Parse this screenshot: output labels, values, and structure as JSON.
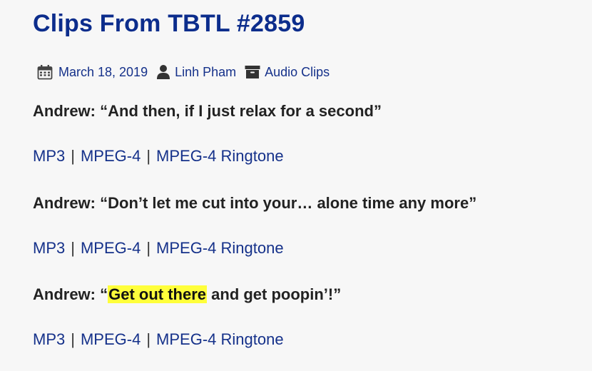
{
  "post": {
    "title": "Clips From TBTL #2859",
    "meta": {
      "date": "March 18, 2019",
      "author": "Linh Pham",
      "category": "Audio Clips"
    },
    "quotes": [
      {
        "prefix": "Andrew: “And then, if I just relax for a second”"
      },
      {
        "prefix": "Andrew: “Don’t let me cut into your… alone time any more”"
      },
      {
        "prefix": "Andrew: “",
        "highlight": "Get out there",
        "suffix": " and get poopin’!”"
      }
    ],
    "links": {
      "mp3": "MP3",
      "mpeg4": "MPEG-4",
      "ringtone": "MPEG-4 Ringtone",
      "separator": "|"
    },
    "colors": {
      "title": "#0c2d8c",
      "link": "#15318a",
      "highlight": "#ffff3b"
    }
  }
}
